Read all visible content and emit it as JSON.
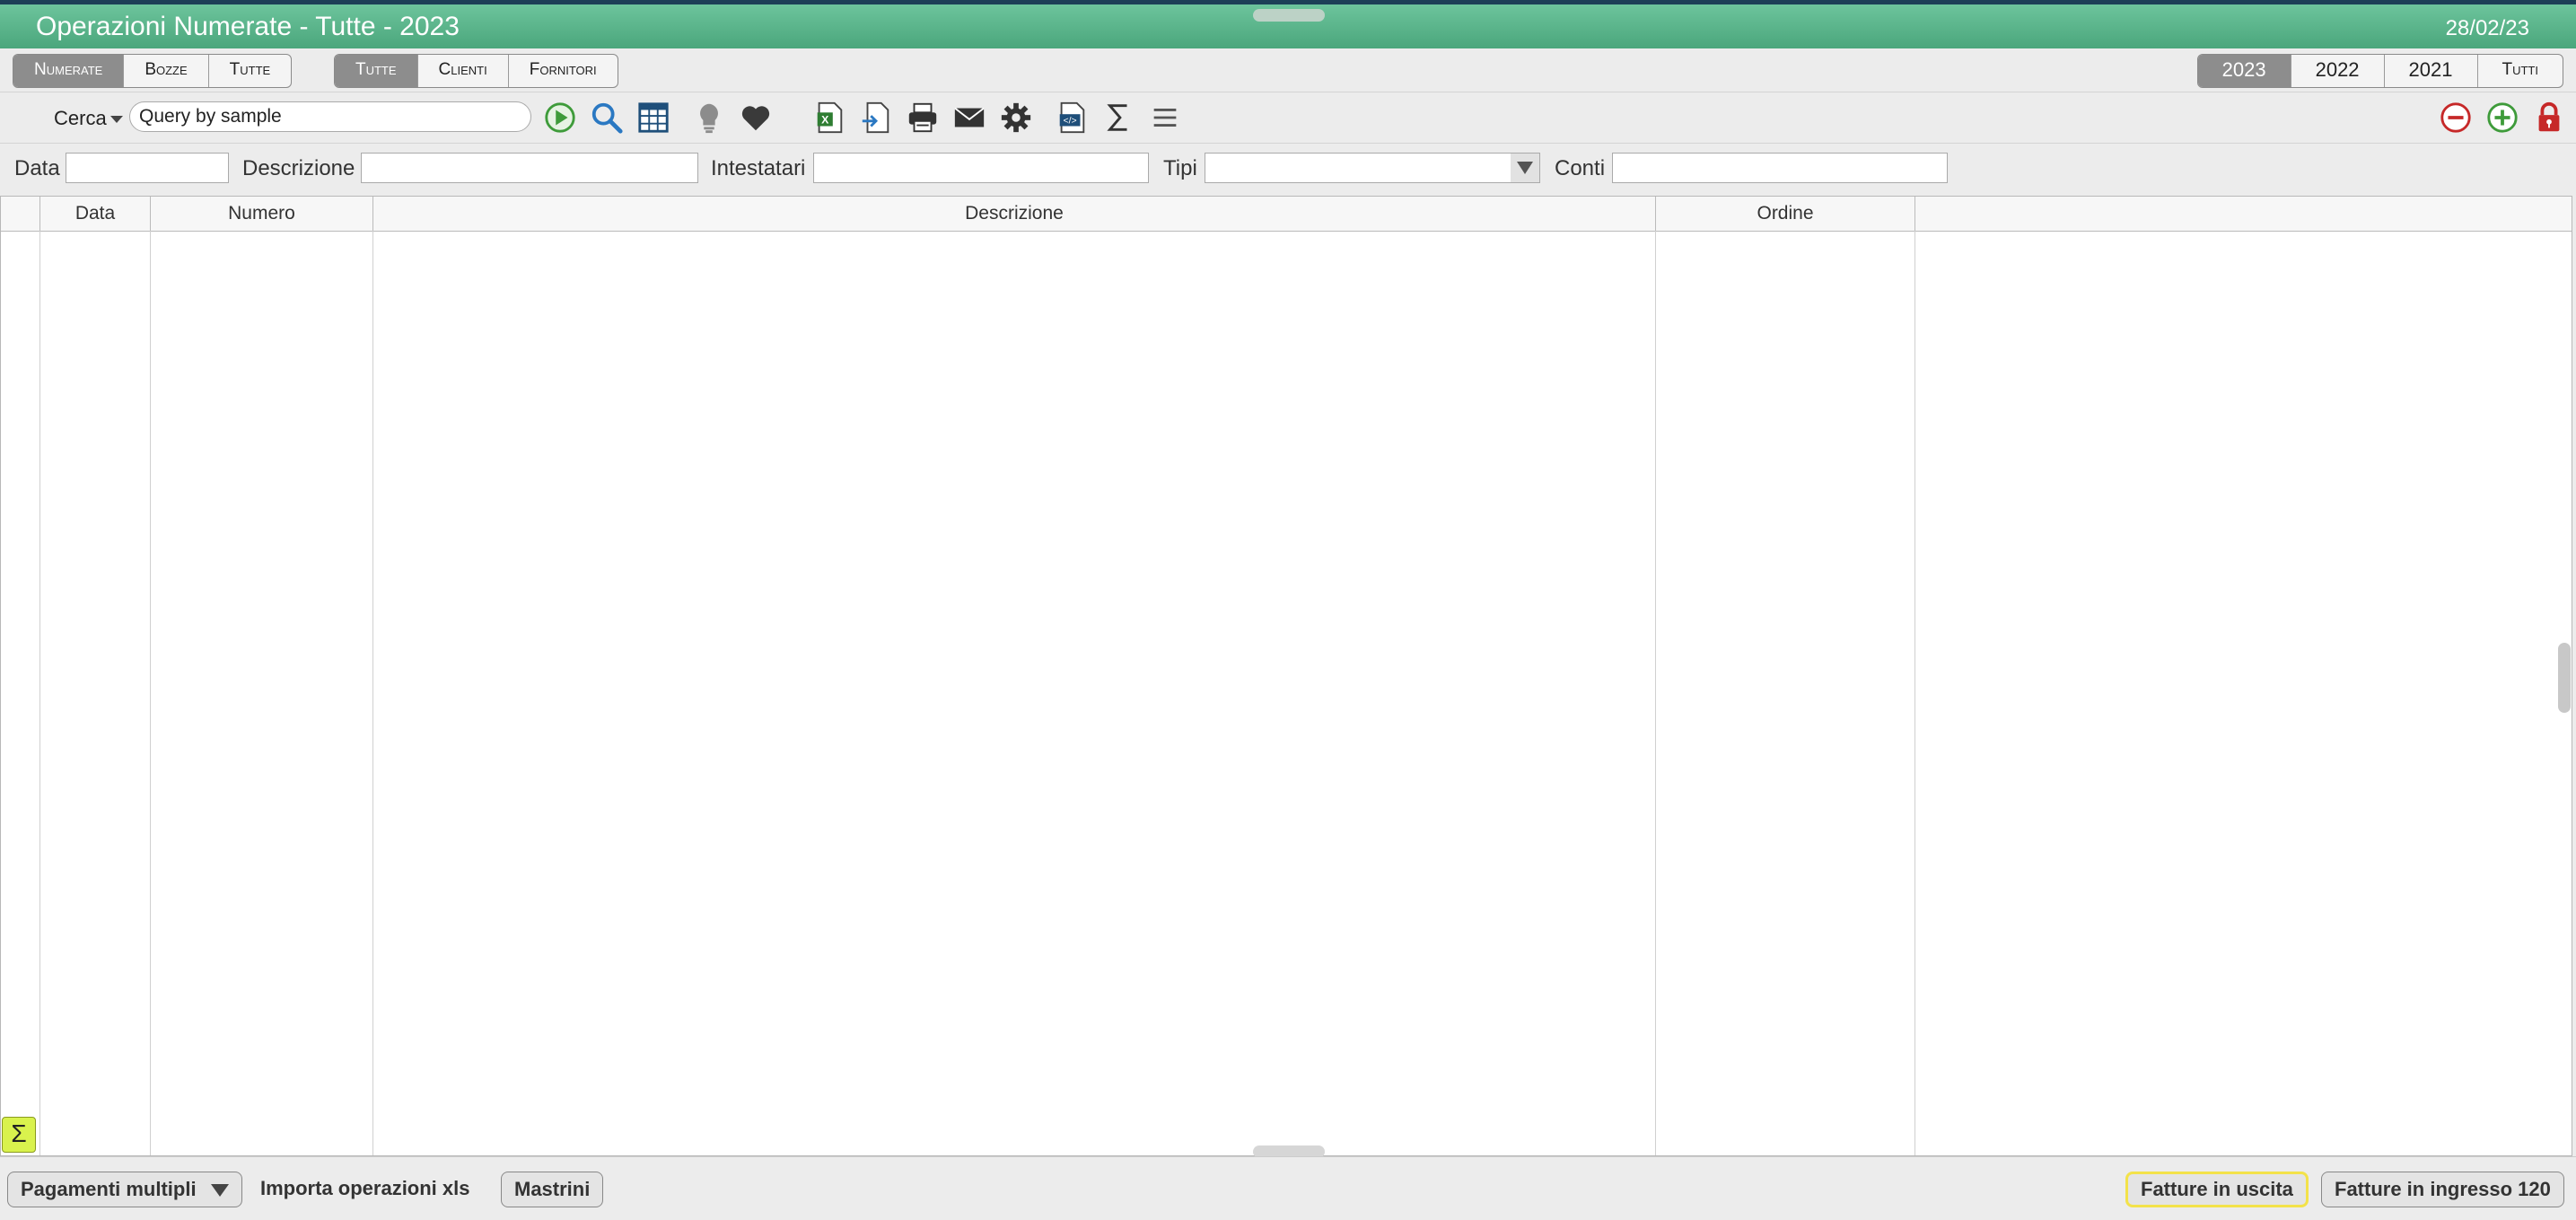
{
  "window": {
    "title": "Operazioni Numerate - Tutte - 2023",
    "date": "28/02/23"
  },
  "filter_tabs": [
    {
      "label": "Numerate",
      "selected": true
    },
    {
      "label": "Bozze",
      "selected": false
    },
    {
      "label": "Tutte",
      "selected": false
    }
  ],
  "party_tabs": [
    {
      "label": "Tutte",
      "selected": true
    },
    {
      "label": "Clienti",
      "selected": false
    },
    {
      "label": "Fornitori",
      "selected": false
    }
  ],
  "year_tabs": [
    {
      "label": "2023",
      "selected": true
    },
    {
      "label": "2022",
      "selected": false
    },
    {
      "label": "2021",
      "selected": false
    },
    {
      "label": "Tutti",
      "selected": false
    }
  ],
  "search": {
    "menu_label": "Cerca",
    "value": "Query by sample"
  },
  "toolbar_icons": [
    "play-icon",
    "search-icon",
    "table-icon",
    "lightbulb-icon",
    "heart-icon",
    "excel-icon",
    "import-icon",
    "print-icon",
    "mail-icon",
    "gear-icon",
    "code-file-icon",
    "sigma-icon",
    "list-icon"
  ],
  "toolbar_right_icons": [
    "remove-icon",
    "add-icon",
    "lock-icon"
  ],
  "filters": {
    "data": "Data",
    "descrizione": "Descrizione",
    "intestatari": "Intestatari",
    "tipi": "Tipi",
    "conti": "Conti"
  },
  "table": {
    "columns": [
      "Data",
      "Numero",
      "Descrizione",
      "Ordine"
    ],
    "rows": []
  },
  "bottom": {
    "pagamenti": "Pagamenti multipli",
    "importa": "Importa operazioni xls",
    "mastrini": "Mastrini",
    "fatture_uscita": "Fatture in uscita",
    "fatture_ingresso": "Fatture in ingresso 120"
  },
  "sigma_label": "Σ",
  "colors": {
    "titlebar": "#4ba67c",
    "accent_yellow": "#d9f24d",
    "selected_tab": "#8d8d8d"
  }
}
